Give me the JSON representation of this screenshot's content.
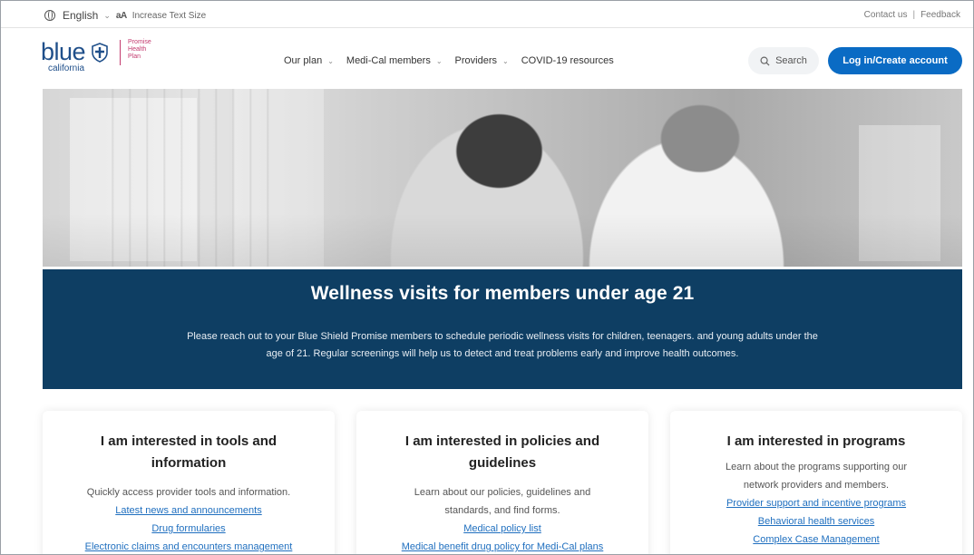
{
  "utility": {
    "language": "English",
    "text_size_icon": "aA",
    "text_size_label": "Increase Text Size",
    "contact": "Contact us",
    "separator": "|",
    "feedback": "Feedback"
  },
  "logo": {
    "word": "blue",
    "sub": "california",
    "promise": "Promise",
    "health": "Health",
    "plan": "Plan"
  },
  "nav": {
    "items": [
      "Our plan",
      "Medi-Cal members",
      "Providers",
      "COVID-19 resources"
    ]
  },
  "search": {
    "label": "Search"
  },
  "login": {
    "label": "Log in/Create account"
  },
  "banner": {
    "title": "Wellness visits for members under age 21",
    "line1": "Please reach out to your Blue Shield Promise members to schedule periodic wellness visits for children, teenagers. and young adults under the",
    "line2": "age of 21. Regular screenings will help us to detect and treat problems early and improve health outcomes."
  },
  "cards": [
    {
      "title1": "I am interested in tools and",
      "title2": "information",
      "desc1": "Quickly access provider tools and information.",
      "links": [
        "Latest news and announcements",
        "Drug formularies",
        "Electronic claims and encounters management"
      ]
    },
    {
      "title1": "I am interested in policies and",
      "title2": "guidelines",
      "desc1": "Learn about our policies, guidelines and",
      "desc2": "standards, and find forms.",
      "links": [
        "Medical policy list",
        "Medical benefit drug policy for Medi-Cal plans"
      ]
    },
    {
      "title1": "I am interested in programs",
      "desc1": "Learn about the programs supporting our",
      "desc2": "network providers and members.",
      "links": [
        "Provider support and incentive programs",
        "Behavioral health services",
        "Complex Case Management"
      ]
    }
  ],
  "colors": {
    "brand_blue": "#1f4f8a",
    "button_blue": "#0a6bc4",
    "banner_navy": "#0e3e63",
    "link_blue": "#1f6fbf",
    "promise_magenta": "#c33a6e"
  }
}
